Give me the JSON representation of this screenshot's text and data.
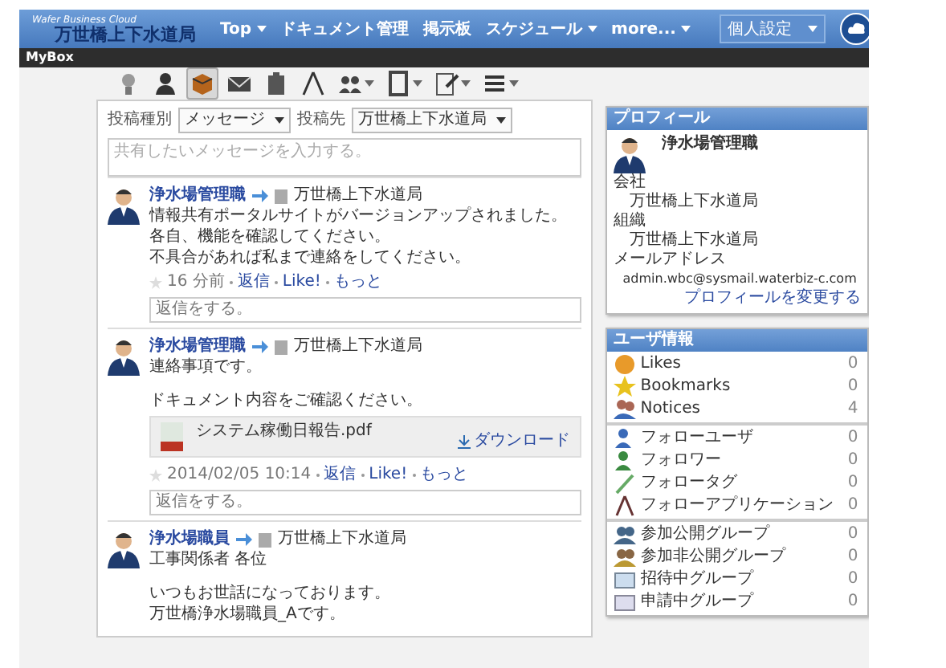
{
  "header": {
    "logo_subtitle": "Wafer Business Cloud",
    "logo_title": "万世橋上下水道局",
    "nav": [
      {
        "label": "Top",
        "dropdown": true
      },
      {
        "label": "ドキュメント管理",
        "dropdown": false
      },
      {
        "label": "掲示板",
        "dropdown": false
      },
      {
        "label": "スケジュール",
        "dropdown": true
      },
      {
        "label": "more...",
        "dropdown": true
      }
    ],
    "settings_button": "個人設定"
  },
  "page_bar": {
    "title": "MyBox"
  },
  "toolbar": [
    {
      "kind": "bulb",
      "selected": false,
      "dropdown": false
    },
    {
      "kind": "person",
      "selected": false,
      "dropdown": false
    },
    {
      "kind": "box",
      "selected": true,
      "dropdown": false
    },
    {
      "kind": "mail",
      "selected": false,
      "dropdown": false
    },
    {
      "kind": "clipboard",
      "selected": false,
      "dropdown": false
    },
    {
      "kind": "compass",
      "selected": false,
      "dropdown": false
    },
    {
      "kind": "people",
      "selected": false,
      "dropdown": true
    },
    {
      "kind": "tablet",
      "selected": false,
      "dropdown": true
    },
    {
      "kind": "edit",
      "selected": false,
      "dropdown": true
    },
    {
      "kind": "list",
      "selected": false,
      "dropdown": true
    }
  ],
  "post_form": {
    "type_label": "投稿種別",
    "type_value": "メッセージ",
    "target_label": "投稿先",
    "target_value": "万世橋上下水道局",
    "placeholder": "共有したいメッセージを入力する。"
  },
  "posts": [
    {
      "author": "浄水場管理職",
      "group": "万世橋上下水道局",
      "body": [
        [
          "情報共有ポータルサイトがバージョンアップされました。",
          "各自、機能を確認してください。",
          "不具合があれば私まで連絡をしてください。"
        ]
      ],
      "time": "16 分前",
      "actions": [
        "返信",
        "Like!",
        "もっと"
      ],
      "reply_placeholder": "返信をする。"
    },
    {
      "author": "浄水場管理職",
      "group": "万世橋上下水道局",
      "body": [
        [
          "連絡事項です。"
        ],
        [
          "ドキュメント内容をご確認ください。"
        ]
      ],
      "attachment": {
        "name": "システム稼働日報告.pdf",
        "download": "ダウンロード"
      },
      "time": "2014/02/05 10:14",
      "actions": [
        "返信",
        "Like!",
        "もっと"
      ],
      "reply_placeholder": "返信をする。"
    },
    {
      "author": "浄水場職員",
      "group": "万世橋上下水道局",
      "body": [
        [
          "工事関係者 各位"
        ],
        [
          "いつもお世話になっております。",
          "万世橋浄水場職員_Aです。"
        ]
      ]
    }
  ],
  "profile": {
    "title": "プロフィール",
    "name": "浄水場管理職",
    "fields": [
      {
        "label": "会社",
        "value": "万世橋上下水道局"
      },
      {
        "label": "組織",
        "value": "万世橋上下水道局"
      },
      {
        "label": "メールアドレス",
        "value": "admin.wbc@sysmail.waterbiz-c.com"
      }
    ],
    "edit_link": "プロフィールを変更する"
  },
  "user_info": {
    "title": "ユーザ情報",
    "sections": [
      [
        {
          "kind": "likes",
          "label": "Likes",
          "count": "0"
        },
        {
          "kind": "bookmarks",
          "label": "Bookmarks",
          "count": "0"
        },
        {
          "kind": "notices",
          "label": "Notices",
          "count": "4"
        }
      ],
      [
        {
          "kind": "follow_user",
          "label": "フォローユーザ",
          "count": "0"
        },
        {
          "kind": "follower",
          "label": "フォロワー",
          "count": "0"
        },
        {
          "kind": "follow_tag",
          "label": "フォロータグ",
          "count": "0"
        },
        {
          "kind": "follow_app",
          "label": "フォローアプリケーション",
          "count": "0"
        }
      ],
      [
        {
          "kind": "public_group",
          "label": "参加公開グループ",
          "count": "0"
        },
        {
          "kind": "private_group",
          "label": "参加非公開グループ",
          "count": "0"
        },
        {
          "kind": "invited_group",
          "label": "招待中グループ",
          "count": "0"
        },
        {
          "kind": "pending_group",
          "label": "申請中グループ",
          "count": "0"
        }
      ]
    ]
  }
}
